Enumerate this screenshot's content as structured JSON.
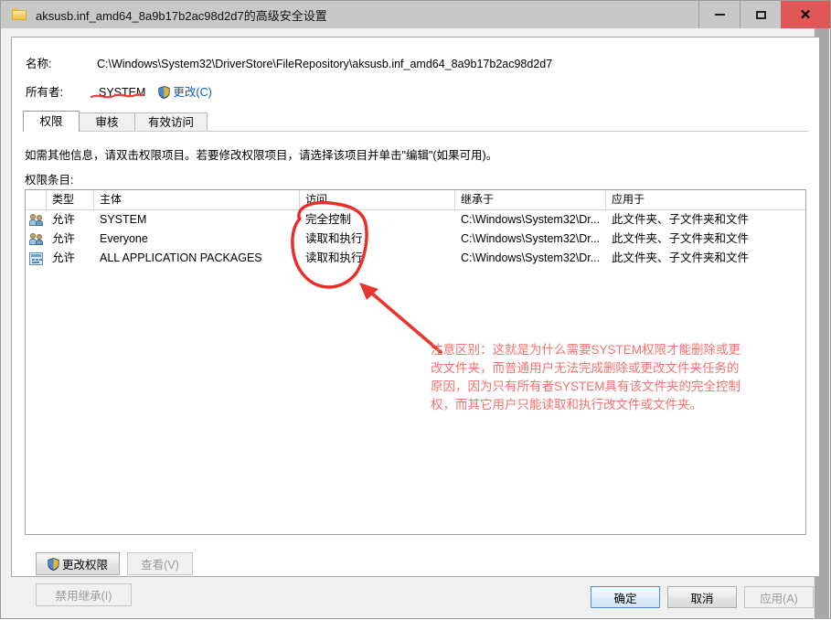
{
  "window": {
    "title": "aksusb.inf_amd64_8a9b17b2ac98d2d7的高级安全设置",
    "folder_icon": "folder-icon",
    "minimize_label": "",
    "maximize_label": "",
    "close_label": "✕"
  },
  "header": {
    "name_label": "名称:",
    "name_value": "C:\\Windows\\System32\\DriverStore\\FileRepository\\aksusb.inf_amd64_8a9b17b2ac98d2d7",
    "owner_label": "所有者:",
    "owner_value": "SYSTEM",
    "owner_change_link": "更改(C)",
    "shield_icon": "shield-icon"
  },
  "tabs": [
    {
      "label": "权限",
      "active": true
    },
    {
      "label": "审核",
      "active": false
    },
    {
      "label": "有效访问",
      "active": false
    }
  ],
  "main": {
    "instructions": "如需其他信息，请双击权限项目。若要修改权限项目，请选择该项目并单击\"编辑\"(如果可用)。",
    "entries_label": "权限条目:"
  },
  "table": {
    "columns": [
      "",
      "类型",
      "主体",
      "访问",
      "继承于",
      "应用于"
    ],
    "rows": [
      {
        "icon": "users-icon",
        "type": "允许",
        "principal": "SYSTEM",
        "access": "完全控制",
        "inherited_from": "C:\\Windows\\System32\\Dr...",
        "applies_to": "此文件夹、子文件夹和文件"
      },
      {
        "icon": "users-icon",
        "type": "允许",
        "principal": "Everyone",
        "access": "读取和执行",
        "inherited_from": "C:\\Windows\\System32\\Dr...",
        "applies_to": "此文件夹、子文件夹和文件"
      },
      {
        "icon": "app-package-icon",
        "type": "允许",
        "principal": "ALL APPLICATION PACKAGES",
        "access": "读取和执行",
        "inherited_from": "C:\\Windows\\System32\\Dr...",
        "applies_to": "此文件夹、子文件夹和文件"
      }
    ]
  },
  "buttons": {
    "change_permissions": "更改权限",
    "view": "查看(V)",
    "disable_inheritance": "禁用继承(I)",
    "ok": "确定",
    "cancel": "取消",
    "apply": "应用(A)"
  },
  "annotation": {
    "text": "注意区别：这就是为什么需要SYSTEM权限才能删除或更改文件夹，而普通用户无法完成删除或更改文件夹任务的原因，因为只有所有者SYSTEM具有该文件夹的完全控制权，而其它用户只能读取和执行改文件或文件夹。",
    "color": "#f5726f",
    "circle_target": "access-column",
    "underline_target": "owner-value"
  }
}
